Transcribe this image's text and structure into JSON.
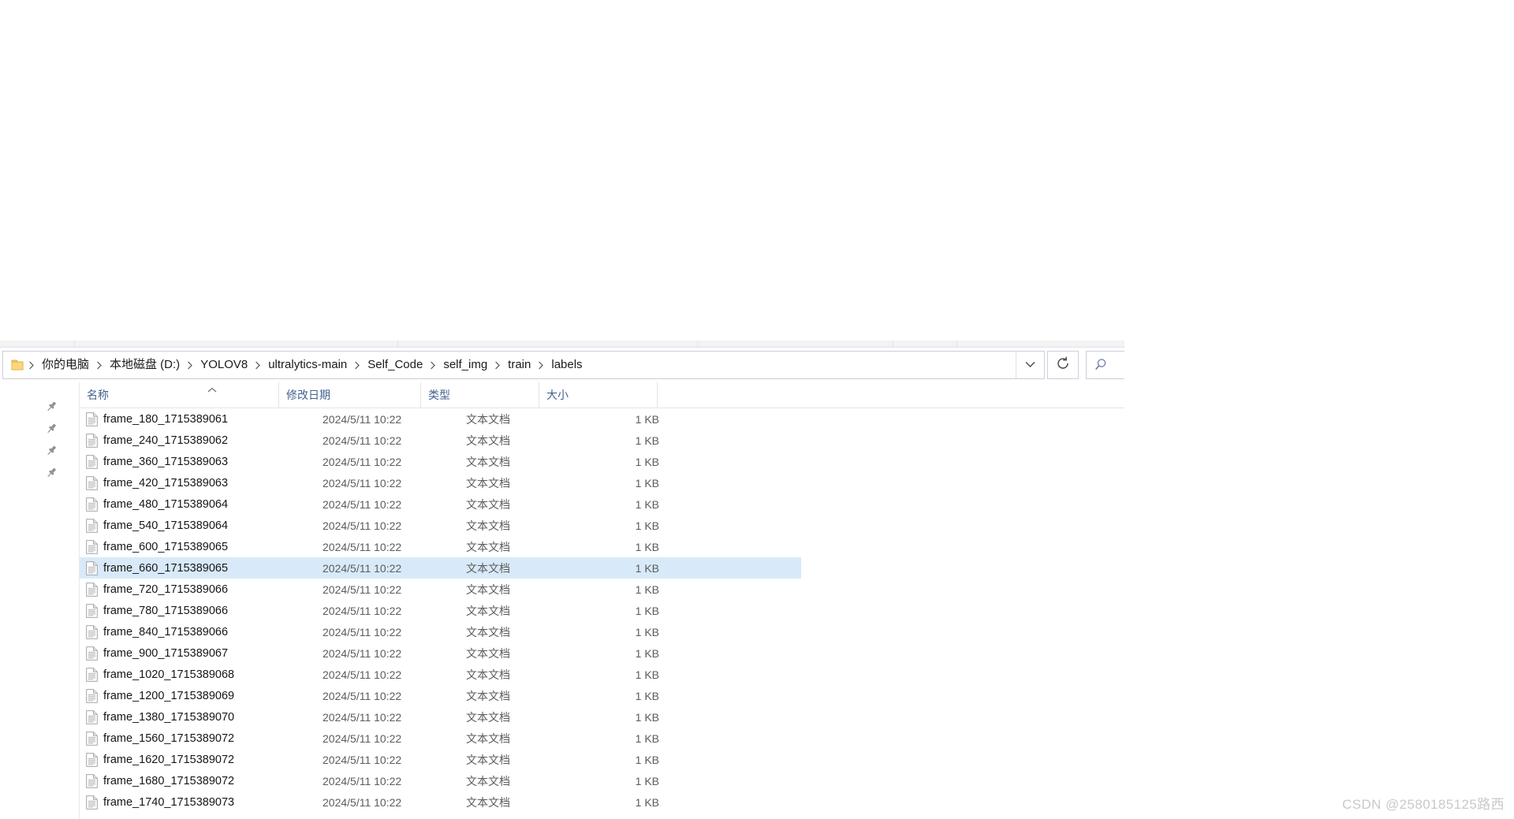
{
  "window": {
    "title": "labels"
  },
  "address_bar": {
    "folder_icon": "folder-icon",
    "breadcrumbs": [
      "你的电脑",
      "本地磁盘 (D:)",
      "YOLOV8",
      "ultralytics-main",
      "Self_Code",
      "self_img",
      "train",
      "labels"
    ],
    "dropdown_icon": "chevron-down-icon",
    "refresh_icon": "refresh-icon",
    "search_icon": "search-icon",
    "search_placeholder": "",
    "search_value": ""
  },
  "nav_pane": {
    "pins": [
      "pin-icon",
      "pin-icon",
      "pin-icon",
      "pin-icon"
    ]
  },
  "file_list": {
    "columns": [
      {
        "label": "名称",
        "align": "left"
      },
      {
        "label": "修改日期",
        "align": "left"
      },
      {
        "label": "类型",
        "align": "left"
      },
      {
        "label": "大小",
        "align": "left"
      }
    ],
    "sort_column": "名称",
    "sort_direction": "ascending",
    "selected_index": 7,
    "rows": [
      {
        "name": "frame_180_1715389061",
        "date": "2024/5/11 10:22",
        "type": "文本文档",
        "size": "1 KB"
      },
      {
        "name": "frame_240_1715389062",
        "date": "2024/5/11 10:22",
        "type": "文本文档",
        "size": "1 KB"
      },
      {
        "name": "frame_360_1715389063",
        "date": "2024/5/11 10:22",
        "type": "文本文档",
        "size": "1 KB"
      },
      {
        "name": "frame_420_1715389063",
        "date": "2024/5/11 10:22",
        "type": "文本文档",
        "size": "1 KB"
      },
      {
        "name": "frame_480_1715389064",
        "date": "2024/5/11 10:22",
        "type": "文本文档",
        "size": "1 KB"
      },
      {
        "name": "frame_540_1715389064",
        "date": "2024/5/11 10:22",
        "type": "文本文档",
        "size": "1 KB"
      },
      {
        "name": "frame_600_1715389065",
        "date": "2024/5/11 10:22",
        "type": "文本文档",
        "size": "1 KB"
      },
      {
        "name": "frame_660_1715389065",
        "date": "2024/5/11 10:22",
        "type": "文本文档",
        "size": "1 KB"
      },
      {
        "name": "frame_720_1715389066",
        "date": "2024/5/11 10:22",
        "type": "文本文档",
        "size": "1 KB"
      },
      {
        "name": "frame_780_1715389066",
        "date": "2024/5/11 10:22",
        "type": "文本文档",
        "size": "1 KB"
      },
      {
        "name": "frame_840_1715389066",
        "date": "2024/5/11 10:22",
        "type": "文本文档",
        "size": "1 KB"
      },
      {
        "name": "frame_900_1715389067",
        "date": "2024/5/11 10:22",
        "type": "文本文档",
        "size": "1 KB"
      },
      {
        "name": "frame_1020_1715389068",
        "date": "2024/5/11 10:22",
        "type": "文本文档",
        "size": "1 KB"
      },
      {
        "name": "frame_1200_1715389069",
        "date": "2024/5/11 10:22",
        "type": "文本文档",
        "size": "1 KB"
      },
      {
        "name": "frame_1380_1715389070",
        "date": "2024/5/11 10:22",
        "type": "文本文档",
        "size": "1 KB"
      },
      {
        "name": "frame_1560_1715389072",
        "date": "2024/5/11 10:22",
        "type": "文本文档",
        "size": "1 KB"
      },
      {
        "name": "frame_1620_1715389072",
        "date": "2024/5/11 10:22",
        "type": "文本文档",
        "size": "1 KB"
      },
      {
        "name": "frame_1680_1715389072",
        "date": "2024/5/11 10:22",
        "type": "文本文档",
        "size": "1 KB"
      },
      {
        "name": "frame_1740_1715389073",
        "date": "2024/5/11 10:22",
        "type": "文本文档",
        "size": "1 KB"
      }
    ]
  },
  "watermark": {
    "text": "CSDN @2580185125路西"
  },
  "colors": {
    "selection": "#d8eaf9",
    "header_text": "#44618e",
    "border": "#cccedb",
    "folder_yellow": "#ffd66b",
    "pin_gray": "#8a9399"
  }
}
